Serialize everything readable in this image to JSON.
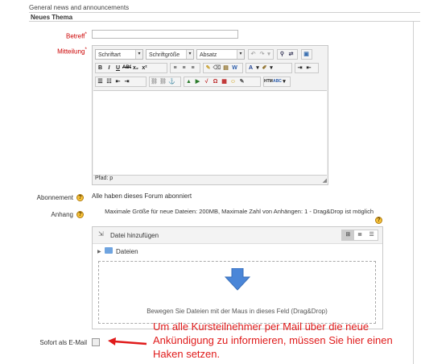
{
  "header": {
    "title": "General news and announcements"
  },
  "fieldset": {
    "legend": "Neues Thema"
  },
  "subject": {
    "label": "Betreff",
    "required_marker": "*",
    "value": ""
  },
  "message": {
    "label": "Mitteilung",
    "required_marker": "*",
    "font_family": "Schriftart",
    "font_size": "Schriftgröße",
    "format": "Absatz",
    "path_label": "Pfad: p"
  },
  "subscription": {
    "label": "Abonnement",
    "text": "Alle haben dieses Forum abonniert"
  },
  "attachment": {
    "label": "Anhang",
    "max_info": "Maximale Größe für neue Dateien: 200MB, Maximale Zahl von Anhängen: 1 - Drag&Drop ist möglich",
    "add_file_label": "Datei hinzufügen",
    "folder_label": "Dateien",
    "drop_text": "Bewegen Sie Dateien mit der Maus in dieses Feld (Drag&Drop)"
  },
  "mail_now": {
    "label": "Sofort als E-Mail",
    "checked": false
  },
  "annotation": {
    "text": "Um alle Kursteilnehmer per Mail über die neue Ankündigung zu informieren, müssen Sie hier einen Haken setzen."
  },
  "colors": {
    "annotation": "#e01b1b",
    "required": "#cc0000",
    "accent_arrow": "#4a86d8"
  }
}
